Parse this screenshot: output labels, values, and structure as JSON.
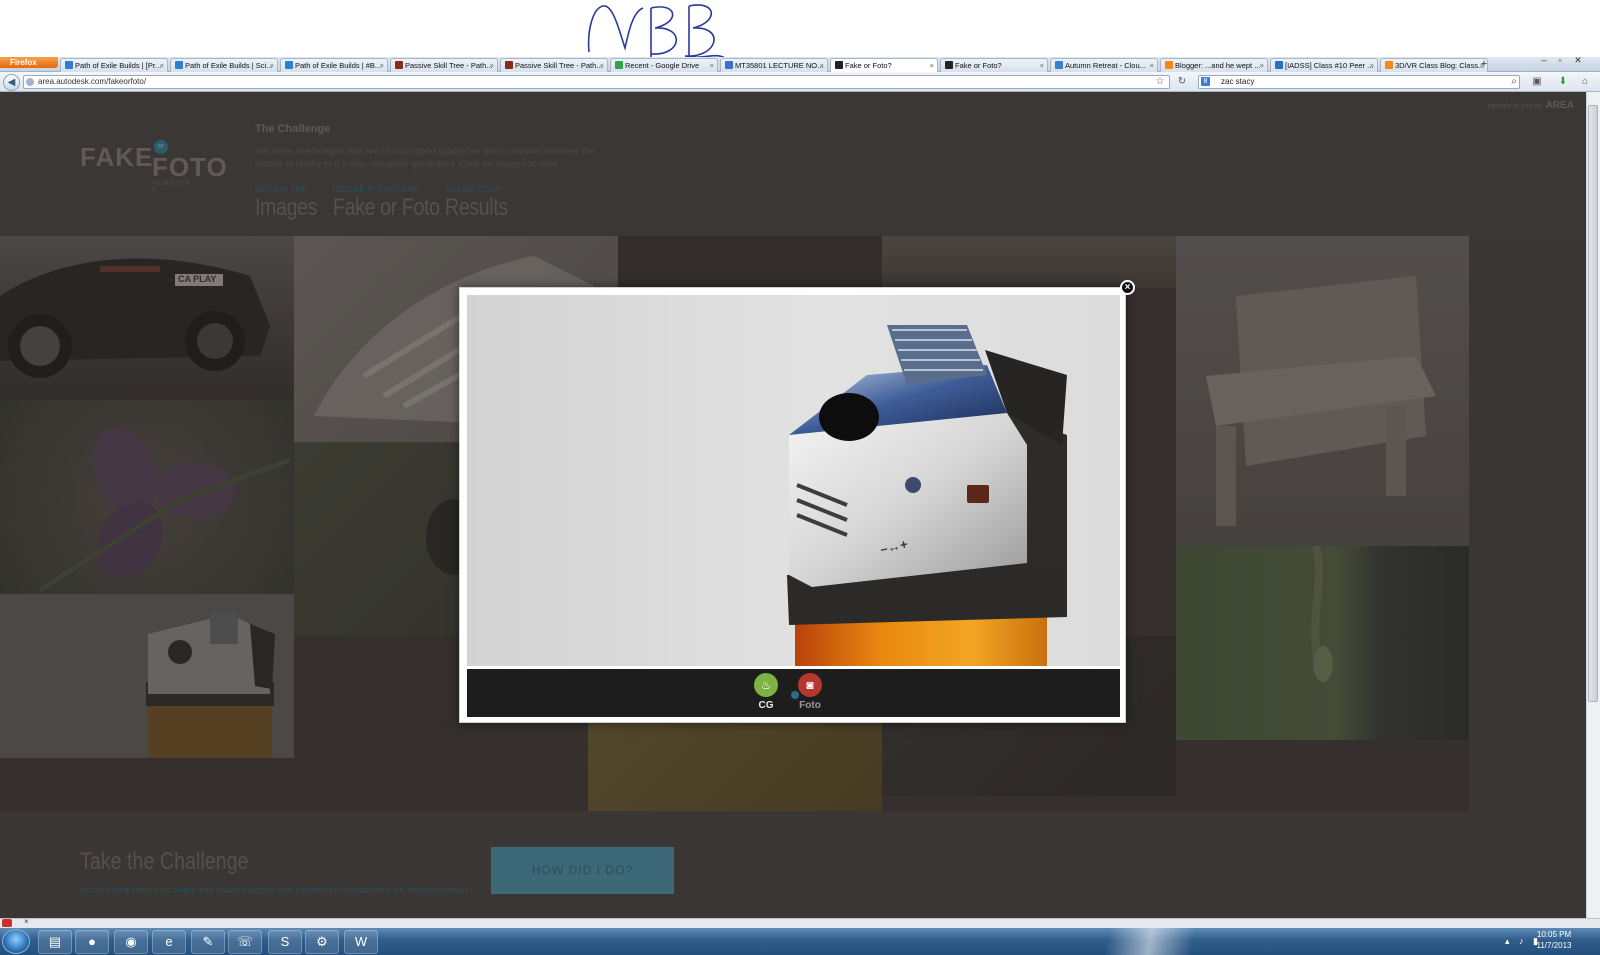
{
  "colors": {
    "page_bg": "#4a4543",
    "accent_blue": "#4fa1bd",
    "cg_green": "#7cb342",
    "foto_red": "#b5372f",
    "taskbar": "#2f5d8c"
  },
  "browser": {
    "menu_button": "Firefox",
    "tabs": [
      {
        "label": "Path of Exile Builds | [Pr...",
        "icon": "ie-icon"
      },
      {
        "label": "Path of Exile Builds | Sci...",
        "icon": "ie-icon"
      },
      {
        "label": "Path of Exile Builds | #B...",
        "icon": "ie-icon"
      },
      {
        "label": "Passive Skill Tree - Path...",
        "icon": "poe-icon"
      },
      {
        "label": "Passive Skill Tree - Path...",
        "icon": "poe-icon"
      },
      {
        "label": "Recent - Google Drive",
        "icon": "drive-icon"
      },
      {
        "label": "MT35801 LECTURE NO...",
        "icon": "doc-icon"
      },
      {
        "label": "Fake or Foto?",
        "icon": "area-icon"
      },
      {
        "label": "Fake or Foto?",
        "icon": "area-icon"
      },
      {
        "label": "Autumn Retreat - Clou...",
        "icon": "leaf-icon"
      },
      {
        "label": "Blogger: ...and he wept ...",
        "icon": "blogger-icon"
      },
      {
        "label": "[IADSS] Class #10 Peer ...",
        "icon": "chat-icon"
      },
      {
        "label": "3D/VR Class Blog: Class...",
        "icon": "blogger-icon"
      }
    ],
    "url": "area.autodesk.com/fakeorfoto/",
    "search_value": "zac stacy",
    "search_engine": "8"
  },
  "page": {
    "brand_note_prefix": "brought to you by",
    "brand_note_name": "AREA",
    "logo": {
      "fake": "FAKE",
      "or": "or",
      "foto": "FOTO",
      "version": "VERSION 5"
    },
    "challenge_title": "The Challenge",
    "challenge_text": "We often see images that are of such good quality we don't consider whether the picture is reality or if it was computer generated. Click on images to vote.",
    "steps": [
      {
        "small": "REVIEW THE",
        "big": "Images"
      },
      {
        "small": "DECIDE IF THEY ARE",
        "big": "Fake or Foto"
      },
      {
        "small": "SHARE YOUR",
        "big": "Results"
      }
    ],
    "gallery_car_plate": "CA PLAY",
    "take_title": "Take the Challenge",
    "take_sub": "SELECT WHETHER YOU THINK THE IMAGES ABOVE ARE COMPUTER-GENERATED OR PHOTOGRAPHIC.",
    "how_button": "HOW DID I DO?"
  },
  "modal": {
    "close": "×",
    "vote_cg": "CG",
    "vote_foto": "Foto",
    "lighter_marking": "–↔+"
  },
  "taskbar": {
    "time": "10:05 PM",
    "date": "11/7/2013",
    "apps": [
      "explorer-icon",
      "firefox-icon",
      "chrome-icon",
      "ie-icon",
      "paint-icon",
      "gtalk-icon",
      "skype-icon",
      "steam-icon",
      "word-icon"
    ]
  }
}
